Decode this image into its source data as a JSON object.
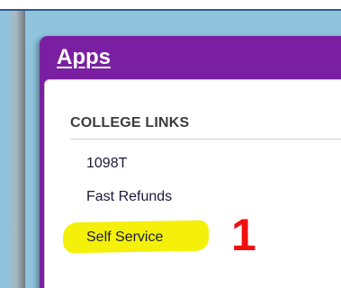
{
  "apps": {
    "title": "Apps",
    "section_title": "COLLEGE LINKS",
    "links": [
      {
        "label": "1098T"
      },
      {
        "label": "Fast Refunds"
      },
      {
        "label": "Self Service"
      }
    ]
  },
  "annotation": {
    "step": "1"
  },
  "colors": {
    "header_bg": "#7b1fa2",
    "highlight": "#f4f00a",
    "annotation": "#f01010",
    "desktop": "#8fc3de"
  }
}
